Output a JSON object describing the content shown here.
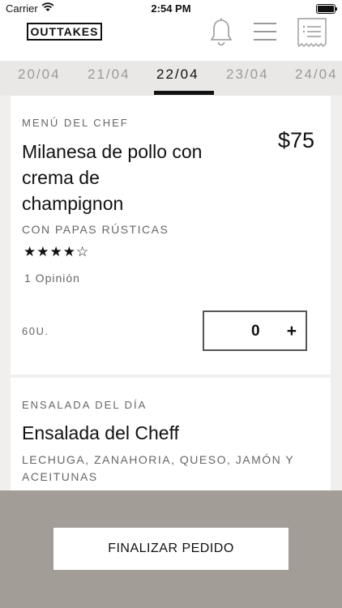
{
  "status_bar": {
    "carrier": "Carrier",
    "time": "2:54 PM"
  },
  "header": {
    "logo": "OUTTAKES",
    "icons": [
      "bell-icon",
      "menu-icon",
      "receipt-icon"
    ]
  },
  "dates": {
    "items": [
      "20/04",
      "21/04",
      "22/04",
      "23/04",
      "24/04"
    ],
    "active": "22/04"
  },
  "menu_items": [
    {
      "category": "MENÚ DEL CHEF",
      "title": "Milanesa de pollo con crema de champignon",
      "title_lines": [
        "Milanesa de pollo con",
        "crema de",
        "champignon"
      ],
      "price": "$75",
      "subtitle": "CON PAPAS RÚSTICAS",
      "rating": 4,
      "rating_max": 5,
      "stars": "★★★★☆",
      "opinions": "1 Opinión",
      "units": "60U.",
      "quantity": "0",
      "plus": "+"
    },
    {
      "category": "ENSALADA DEL DÍA",
      "title": "Ensalada del Cheff",
      "subtitle_lines": [
        "LECHUGA, ZANAHORIA, QUESO, JAMÓN Y",
        "ACEITUNAS"
      ]
    }
  ],
  "footer": {
    "finalize_label": "FINALIZAR PEDIDO"
  },
  "colors": {
    "footer_bg": "#a29d97",
    "page_bg": "#f0efed",
    "date_bar_bg": "#e9e8e6"
  }
}
